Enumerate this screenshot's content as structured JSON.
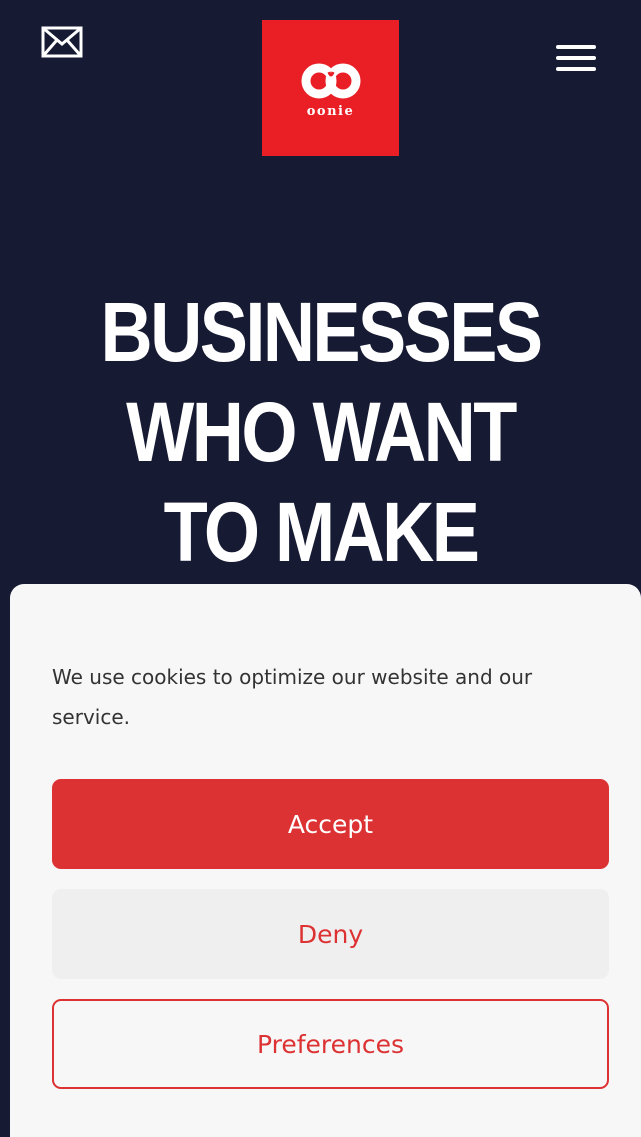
{
  "header": {
    "mail_icon": "envelope-icon",
    "menu_icon": "hamburger-menu-icon",
    "logo": {
      "text": "oonie",
      "icon": "infinity-loop-icon"
    }
  },
  "hero": {
    "title_lines": [
      "BUSINESSES",
      "WHO WANT",
      "TO MAKE"
    ]
  },
  "cookie_banner": {
    "message": "We use cookies to optimize our website and our service.",
    "accept_label": "Accept",
    "deny_label": "Deny",
    "preferences_label": "Preferences"
  },
  "colors": {
    "page_background": "#161b33",
    "logo_red": "#ea1f26",
    "accent_red": "#dd3233",
    "panel_background": "#f7f7f7"
  }
}
